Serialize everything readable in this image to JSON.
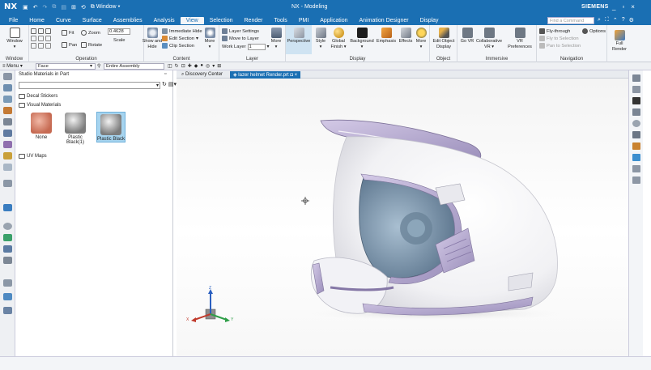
{
  "app": {
    "logo": "NX",
    "window_title": "NX - Modeling",
    "brand": "SIEMENS",
    "window_menu_label": "Window",
    "controls": [
      "_",
      "▫",
      "×"
    ]
  },
  "menu": {
    "tabs": [
      "File",
      "Home",
      "Curve",
      "Surface",
      "Assemblies",
      "Analysis",
      "View",
      "Selection",
      "Render",
      "Tools",
      "PMI",
      "Application",
      "Animation Designer",
      "Display"
    ],
    "active_tab": "View",
    "search_placeholder": "Find a Command"
  },
  "ribbon": {
    "groups": {
      "window": {
        "label": "Window",
        "button": "Window"
      },
      "operation": {
        "label": "Operation",
        "fit": "Fit",
        "zoom": "Zoom",
        "pan": "Pan",
        "rotate": "Rotate",
        "scale_value": "0.4628",
        "scale": "Scale"
      },
      "content": {
        "label": "Content",
        "show_hide": "Show and Hide",
        "immediate_hide": "Immediate Hide",
        "edit_section": "Edit Section",
        "clip_section": "Clip Section",
        "more": "More"
      },
      "layer": {
        "label": "Layer",
        "layer_settings": "Layer Settings",
        "move_to_layer": "Move to Layer",
        "work_layer": "Work Layer",
        "work_layer_value": "1",
        "more": "More"
      },
      "display": {
        "label": "Display",
        "perspective": "Perspective",
        "style": "Style",
        "global_finish": "Global Finish",
        "background": "Background",
        "emphasis": "Emphasis",
        "effects": "Effects",
        "more": "More"
      },
      "object": {
        "label": "Object",
        "edit_object_display": "Edit Object Display"
      },
      "immersive": {
        "label": "Immersive",
        "go_vr": "Go VR",
        "collaborative_vr": "Collaborative VR",
        "vr_preferences": "VR Preferences"
      },
      "navigation": {
        "label": "Navigation",
        "fly_through": "Fly-through",
        "fly_to_selection": "Fly to Selection",
        "pan_to_selection": "Pan to Selection",
        "options": "Options"
      },
      "render": {
        "full_render": "Full Render"
      }
    }
  },
  "selection_bar": {
    "menu": "Menu",
    "filter": "Face",
    "scope": "Entire Assembly"
  },
  "panel": {
    "title": "Studio Materials in Part",
    "tree": {
      "decal": "Decal Stickers",
      "visual": "Visual Materials",
      "uv": "UV Maps"
    },
    "materials": [
      {
        "label": "None",
        "color": "#d9826e"
      },
      {
        "label": "Plastic Black(1)",
        "color": "#9a9a9a"
      },
      {
        "label": "Plastic Black",
        "color": "#9a9a9a"
      }
    ]
  },
  "view_tabs": {
    "discovery": "Discovery Center",
    "file": "lazer helmet Render.prt"
  },
  "triad": {
    "z": "Z",
    "x": "X",
    "y": "Y"
  },
  "colors": {
    "titlebar": "#1a6fb3",
    "helmet_white": "#fbfbfc",
    "helmet_lavender": "#b8acd0",
    "visor_blue": "#8fa8bd"
  }
}
